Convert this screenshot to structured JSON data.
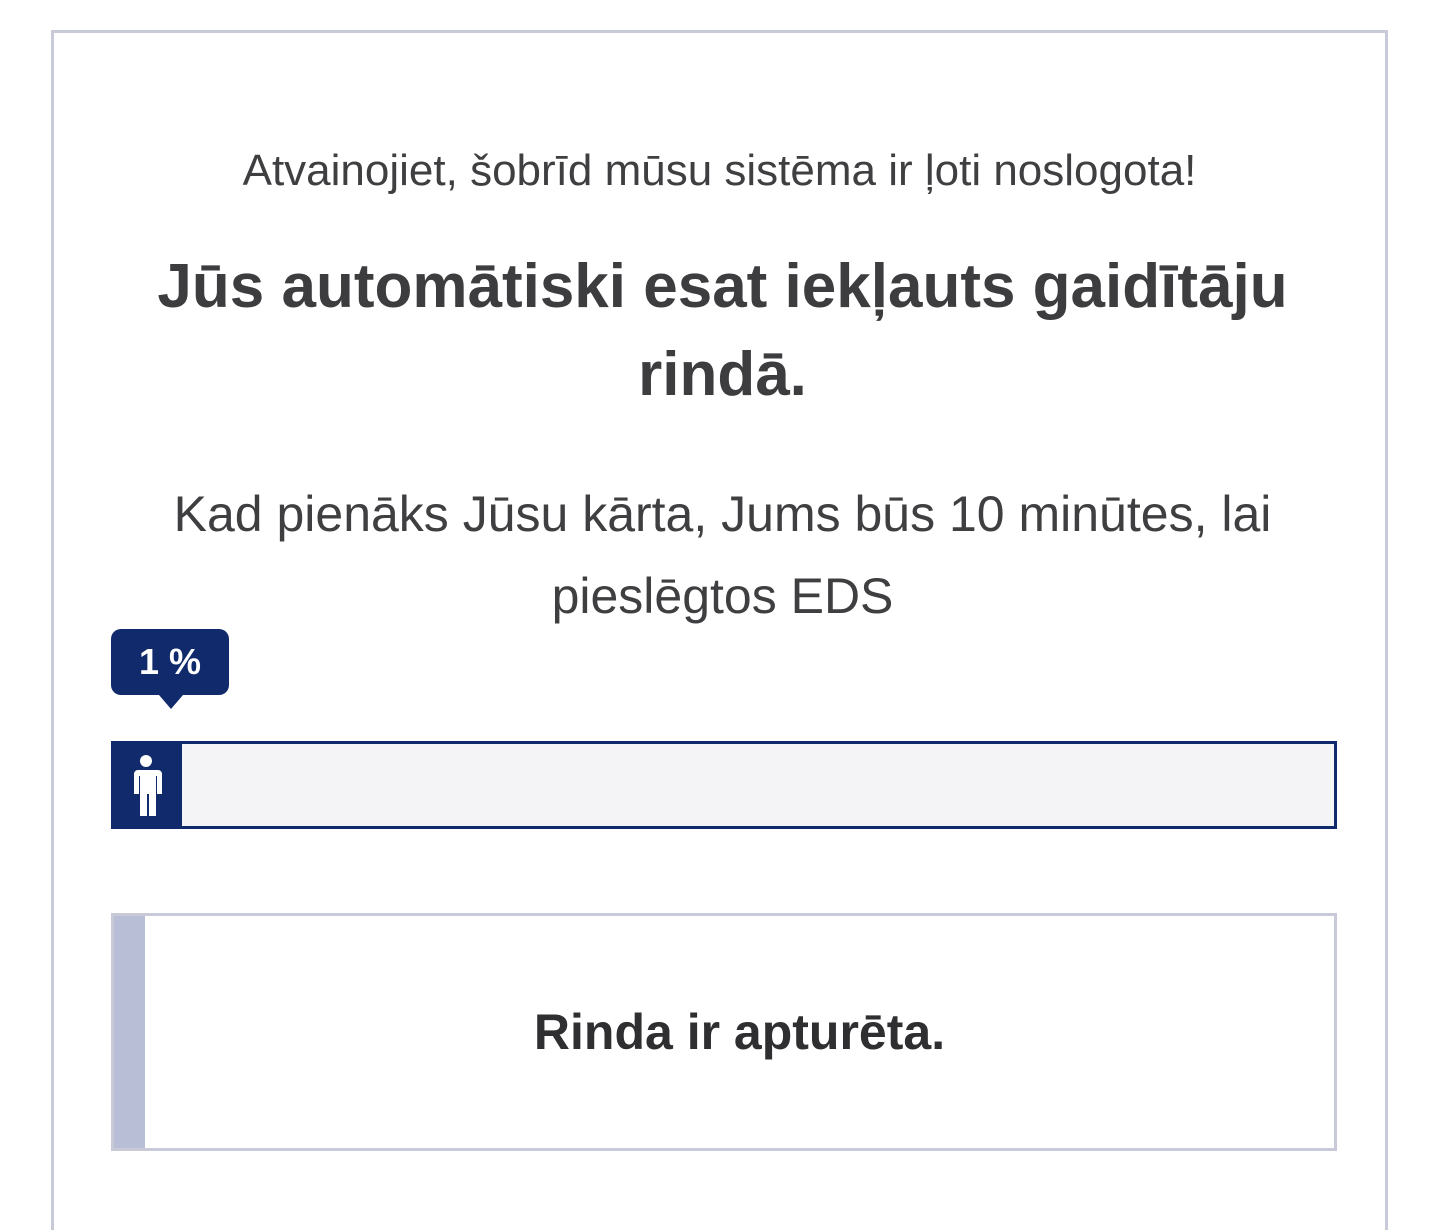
{
  "queue": {
    "apology_text": "Atvainojiet, šobrīd mūsu sistēma ir ļoti noslogota!",
    "headline": "Jūs automātiski esat iekļauts gaidītāju rindā.",
    "info_text": "Kad pienāks Jūsu kārta, Jums būs 10 minūtes, lai pieslēgtos EDS",
    "progress": {
      "label": "1 %",
      "percent": 1,
      "icon": "person-icon"
    },
    "notice": {
      "text": "Rinda ir apturēta."
    }
  },
  "colors": {
    "accent": "#102a6b",
    "border": "#c8cad8",
    "notice_accent": "#b8bed6",
    "bar_background": "#f4f4f6"
  }
}
